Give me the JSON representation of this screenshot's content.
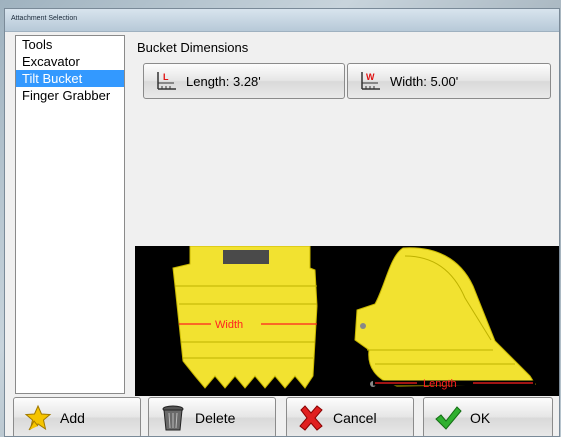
{
  "window": {
    "title": "Attachment Selection"
  },
  "list": {
    "items": [
      {
        "label": "Tools",
        "selected": false
      },
      {
        "label": "Excavator",
        "selected": false
      },
      {
        "label": "Tilt Bucket",
        "selected": true
      },
      {
        "label": "Finger Grabber",
        "selected": false
      }
    ]
  },
  "bucket": {
    "section_label": "Bucket Dimensions",
    "length_label": "Length: 3.28'",
    "width_label": "Width: 5.00'",
    "length_icon_letter": "L",
    "width_icon_letter": "W",
    "diagram": {
      "width_label": "Width",
      "length_label": "Length",
      "bucket_color": "#f2e230",
      "accent_color": "#ff2020"
    }
  },
  "buttons": {
    "add": "Add",
    "delete": "Delete",
    "cancel": "Cancel",
    "ok": "OK"
  }
}
